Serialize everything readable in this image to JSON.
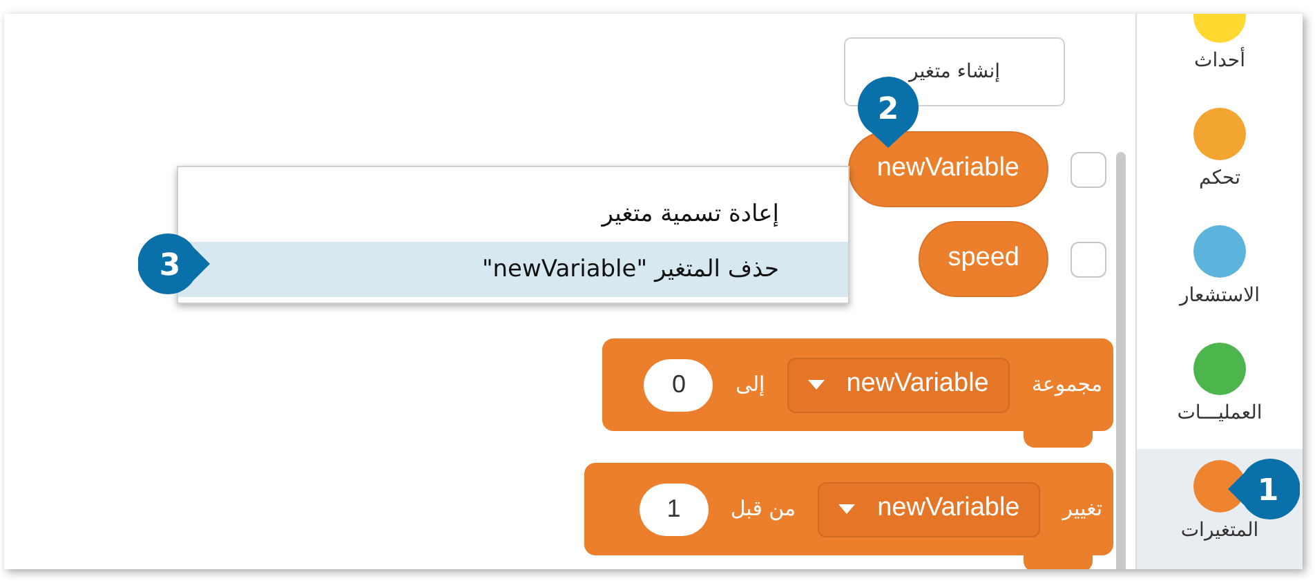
{
  "categories": [
    {
      "label": "أحداث",
      "color": "#ffd92f",
      "selected": false
    },
    {
      "label": "تحكم",
      "color": "#f2a531",
      "selected": false
    },
    {
      "label": "الاستشعار",
      "color": "#5cb3db",
      "selected": false
    },
    {
      "label": "العمليـــات",
      "color": "#4cb54c",
      "selected": false
    },
    {
      "label": "المتغيرات",
      "color": "#ee8430",
      "selected": true
    }
  ],
  "create_variable_button": "إنشاء متغير",
  "variables": [
    {
      "name": "newVariable",
      "checked": false
    },
    {
      "name": "speed",
      "checked": false
    }
  ],
  "context_menu": [
    {
      "label": "إعادة تسمية متغير",
      "selected": false
    },
    {
      "label": "حذف المتغير \"newVariable\"",
      "selected": true
    }
  ],
  "blocks": [
    {
      "parts": [
        {
          "kind": "text",
          "text": "مجموعة"
        },
        {
          "kind": "dropdown",
          "text": "newVariable"
        },
        {
          "kind": "text",
          "text": "إلى"
        },
        {
          "kind": "number",
          "text": "0"
        }
      ]
    },
    {
      "parts": [
        {
          "kind": "text",
          "text": "تغيير"
        },
        {
          "kind": "dropdown",
          "text": "newVariable"
        },
        {
          "kind": "text",
          "text": "من قبل"
        },
        {
          "kind": "number",
          "text": "1"
        }
      ]
    }
  ],
  "callouts": [
    {
      "number": "1"
    },
    {
      "number": "2"
    },
    {
      "number": "3"
    }
  ]
}
